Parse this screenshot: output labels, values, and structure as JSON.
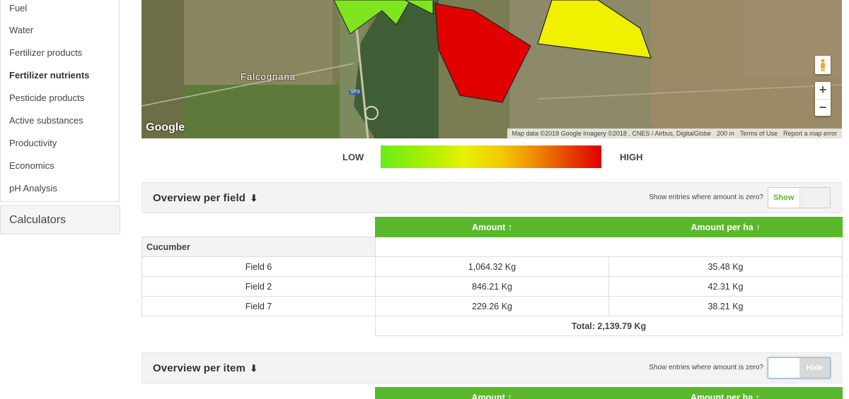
{
  "sidebar": {
    "items": [
      {
        "label": "Fuel",
        "bold": false
      },
      {
        "label": "Water",
        "bold": false
      },
      {
        "label": "Fertilizer products",
        "bold": false
      },
      {
        "label": "Fertilizer nutrients",
        "bold": true
      },
      {
        "label": "Pesticide products",
        "bold": false
      },
      {
        "label": "Active substances",
        "bold": false
      },
      {
        "label": "Productivity",
        "bold": false
      },
      {
        "label": "Economics",
        "bold": false
      },
      {
        "label": "pH Analysis",
        "bold": false
      }
    ],
    "calculators_label": "Calculators"
  },
  "map": {
    "logo": "Google",
    "place_label": "Falcognana",
    "road_label": "SP3",
    "attribution": "Map data ©2018 Google Imagery ©2018 , CNES / Airbus, DigitalGlobe",
    "scale": "200 m",
    "terms": "Terms of Use",
    "report": "Report a map error",
    "zoom_in": "+",
    "zoom_out": "−",
    "field_colors": {
      "green": "#80e51f",
      "red": "#e00000",
      "yellow": "#f0f000"
    }
  },
  "legend": {
    "low": "LOW",
    "high": "HIGH"
  },
  "overview_field": {
    "title": "Overview per field",
    "arrow": "⬇",
    "zero_label": "Show entries where amount is zero?",
    "toggle_label": "Show",
    "col_amount": "Amount ↑",
    "col_amount_ha": "Amount per ha ↑",
    "crop": "Cucumber",
    "rows": [
      {
        "field": "Field 6",
        "amount": "1,064.32 Kg",
        "per_ha": "35.48 Kg"
      },
      {
        "field": "Field 2",
        "amount": "846.21 Kg",
        "per_ha": "42.31 Kg"
      },
      {
        "field": "Field 7",
        "amount": "229.26 Kg",
        "per_ha": "38.21 Kg"
      }
    ],
    "total": "Total: 2,139.79 Kg"
  },
  "overview_item": {
    "title": "Overview per item",
    "arrow": "⬇",
    "zero_label": "Show entries where amount is zero?",
    "toggle_label": "Hide",
    "col_amount": "Amount ↑",
    "col_amount_ha": "Amount per ha ↑"
  },
  "colors": {
    "accent_green": "#5ab82c"
  }
}
